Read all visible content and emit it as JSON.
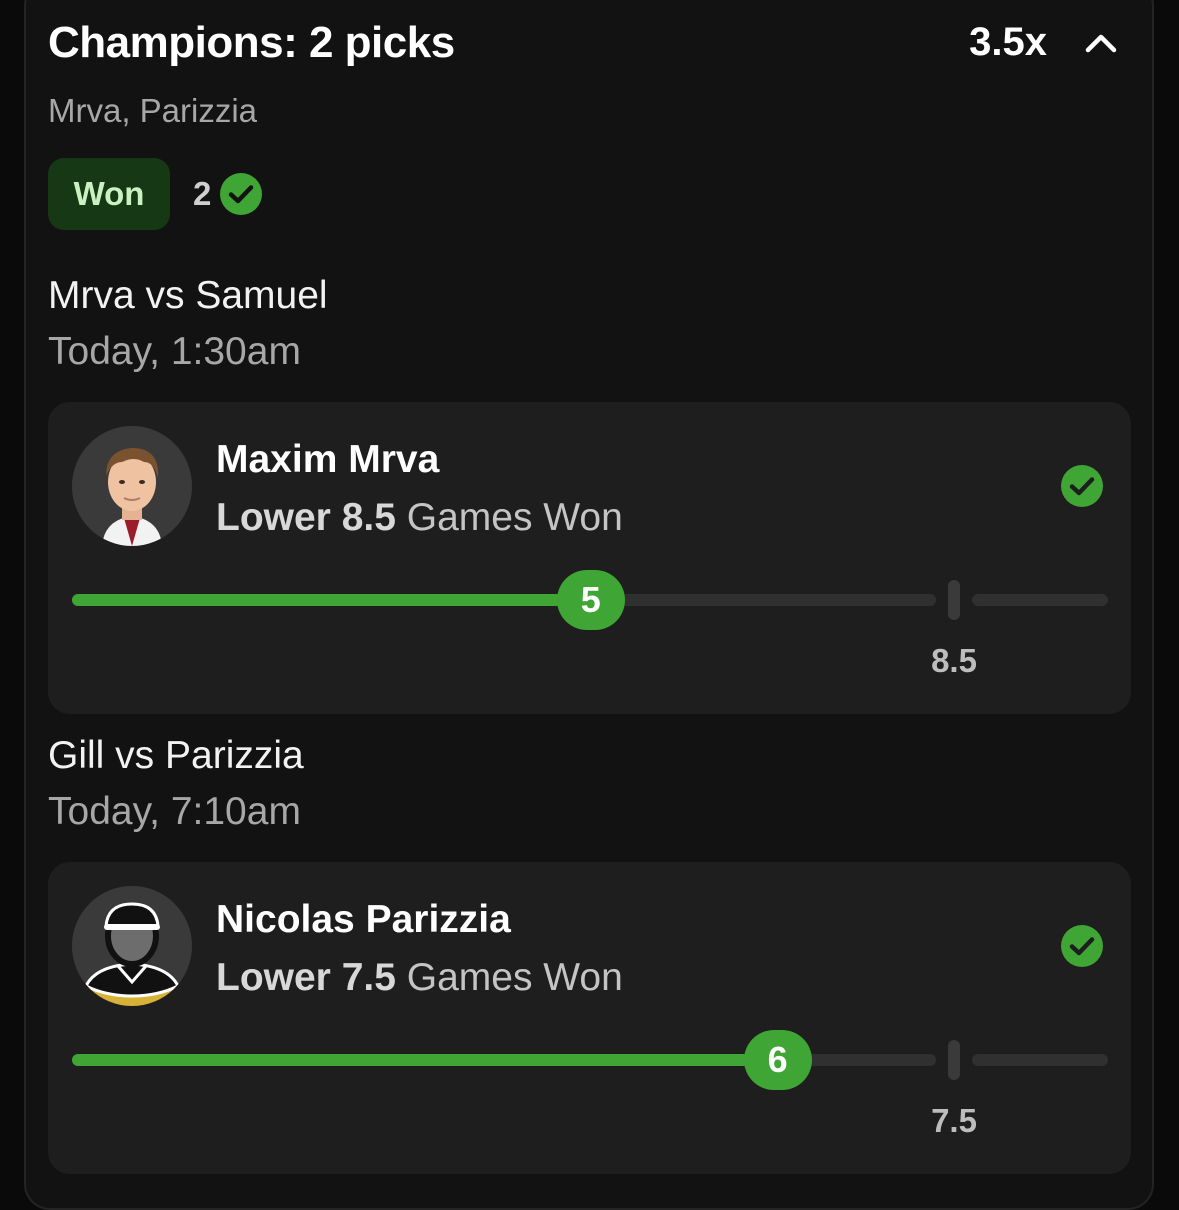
{
  "header": {
    "title": "Champions: 2 picks",
    "multiplier": "3.5x",
    "subtitle": "Mrva, Parizzia",
    "status": "Won",
    "correct_count": "2"
  },
  "colors": {
    "accent_green": "#3fa535",
    "badge_bg": "#163814",
    "badge_text": "#c9f1c1"
  },
  "picks": [
    {
      "match": "Mrva vs Samuel",
      "time": "Today, 1:30am",
      "player": "Maxim Mrva",
      "direction": "Lower",
      "line": "8.5",
      "stat": "Games Won",
      "result": "5",
      "result_value": 5,
      "line_value": 8.5,
      "avatar_icon": "player-photo-icon",
      "status_icon": "check-circle-icon"
    },
    {
      "match": "Gill vs Parizzia",
      "time": "Today, 7:10am",
      "player": "Nicolas Parizzia",
      "direction": "Lower",
      "line": "7.5",
      "stat": "Games Won",
      "result": "6",
      "result_value": 6,
      "line_value": 7.5,
      "avatar_icon": "default-player-silhouette-icon",
      "status_icon": "check-circle-icon"
    }
  ]
}
